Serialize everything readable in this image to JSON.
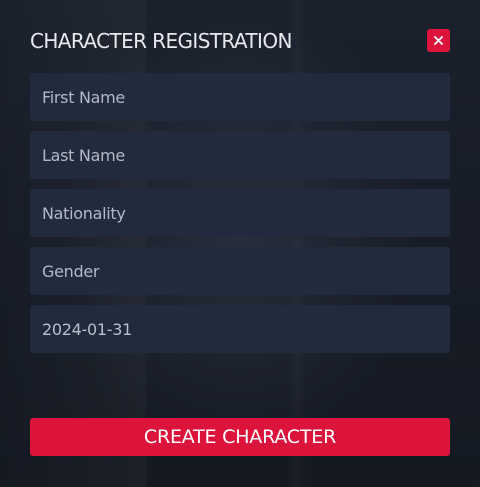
{
  "dialog": {
    "title": "CHARACTER REGISTRATION",
    "close_icon": "close-icon"
  },
  "form": {
    "first_name": {
      "placeholder": "First Name",
      "value": ""
    },
    "last_name": {
      "placeholder": "Last Name",
      "value": ""
    },
    "nationality": {
      "placeholder": "Nationality",
      "value": ""
    },
    "gender": {
      "placeholder": "Gender",
      "value": ""
    },
    "date_of_birth": {
      "value": "2024-01-31"
    }
  },
  "actions": {
    "create_label": "CREATE CHARACTER"
  },
  "colors": {
    "accent": "#dc143c",
    "field_background": "#212b3d",
    "panel_background": "#181d27"
  }
}
